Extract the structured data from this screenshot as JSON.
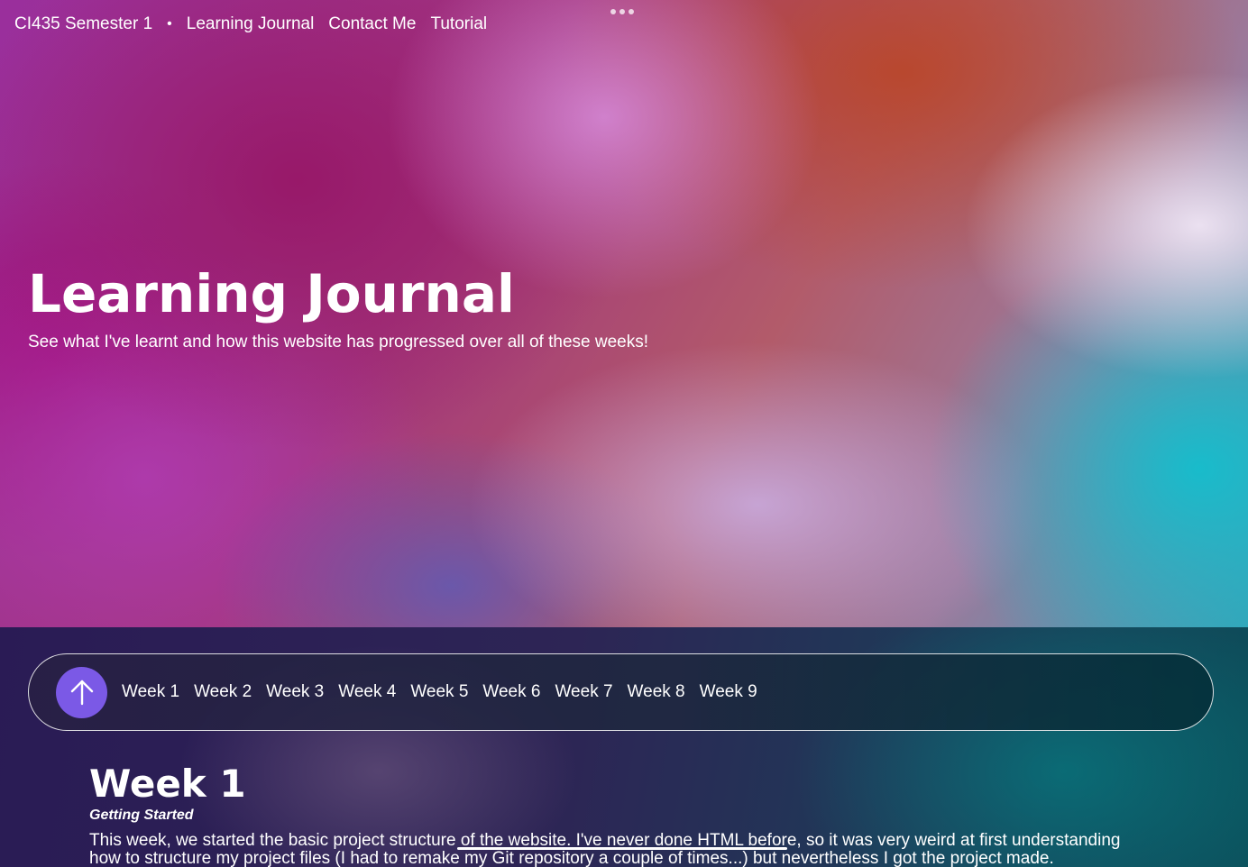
{
  "top_nav": {
    "site_title": "CI435 Semester 1",
    "separator": "•",
    "links": [
      "Learning Journal",
      "Contact Me",
      "Tutorial"
    ]
  },
  "hero": {
    "title": "Learning Journal",
    "subtitle": "See what I've learnt and how this website has progressed over all of these weeks!"
  },
  "week_nav": {
    "up_button_icon": "arrow-up-icon",
    "accent_color": "#7b59e6",
    "weeks": [
      "Week 1",
      "Week 2",
      "Week 3",
      "Week 4",
      "Week 5",
      "Week 6",
      "Week 7",
      "Week 8",
      "Week 9"
    ]
  },
  "week_section": {
    "heading": "Week 1",
    "subheading": "Getting Started",
    "body_line_1": "This week, we started the basic project structure of the website. I've never done HTML before, so it was very weird at first understanding",
    "body_line_2": "how to structure my project files (I had to remake my Git repository a couple of times...) but nevertheless I got the project made."
  },
  "icons": {
    "window_controls": "more-dots-icon",
    "up_button": "arrow-up-icon"
  }
}
